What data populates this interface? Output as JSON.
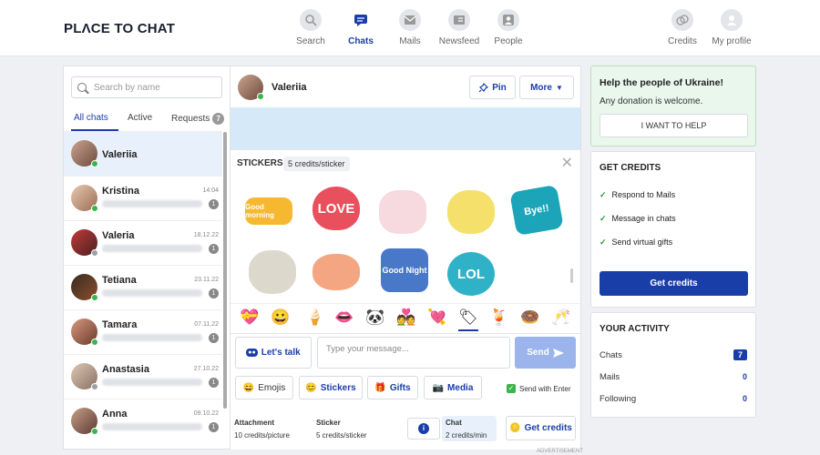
{
  "app": {
    "logo": "PLΛCE TO CHAT"
  },
  "nav": [
    {
      "label": "Search",
      "icon": "search-person-icon"
    },
    {
      "label": "Chats",
      "icon": "chat-icon"
    },
    {
      "label": "Mails",
      "icon": "mail-icon"
    },
    {
      "label": "Newsfeed",
      "icon": "newsfeed-icon"
    },
    {
      "label": "People",
      "icon": "people-icon"
    },
    {
      "label": "Credits",
      "icon": "coins-icon"
    },
    {
      "label": "My profile",
      "icon": "profile-icon"
    }
  ],
  "sidebar": {
    "search_placeholder": "Search by name",
    "tabs": {
      "all": "All chats",
      "active": "Active",
      "requests": "Requests",
      "requests_count": "7"
    },
    "chats": [
      {
        "name": "Valeriia",
        "date": "",
        "count": "",
        "online": true
      },
      {
        "name": "Kristina",
        "date": "14:04",
        "count": "1",
        "online": true
      },
      {
        "name": "Valeria",
        "date": "18.12.22",
        "count": "1",
        "online": false
      },
      {
        "name": "Tetiana",
        "date": "23.11.22",
        "count": "1",
        "online": true
      },
      {
        "name": "Tamara",
        "date": "07.11.22",
        "count": "1",
        "online": true
      },
      {
        "name": "Anastasia",
        "date": "27.10.22",
        "count": "1",
        "online": false
      },
      {
        "name": "Anna",
        "date": "09.10.22",
        "count": "1",
        "online": true
      }
    ]
  },
  "chat": {
    "contact_name": "Valeriia",
    "pin_label": "Pin",
    "more_label": "More",
    "stickers_title": "STICKERS",
    "stickers_price": "5 credits/sticker",
    "sticker_texts": [
      "Good morning",
      "LOVE",
      "",
      "",
      "Bye!!",
      "",
      "",
      "Good Night",
      "LOL"
    ],
    "lets_talk": "Let's talk",
    "message_placeholder": "Type your message...",
    "send_label": "Send",
    "tools": {
      "emojis": "Emojis",
      "stickers": "Stickers",
      "gifts": "Gifts",
      "media": "Media",
      "send_with_enter": "Send with Enter"
    },
    "pricing": {
      "attachment_label": "Attachment",
      "attachment_price": "10 credits/picture",
      "sticker_label": "Sticker",
      "sticker_price": "5 credits/sticker",
      "chat_label": "Chat",
      "chat_price": "2 credits/min"
    },
    "get_credits_label": "Get credits",
    "advertisement": "ADVERTISEMENT"
  },
  "ukraine": {
    "title": "Help the people of Ukraine!",
    "text": "Any donation is welcome.",
    "button": "I WANT TO HELP"
  },
  "credits": {
    "title": "GET CREDITS",
    "items": [
      "Respond to Mails",
      "Message in chats",
      "Send virtual gifts"
    ],
    "button": "Get credits"
  },
  "activity": {
    "title": "YOUR ACTIVITY",
    "rows": [
      {
        "label": "Chats",
        "value": "7"
      },
      {
        "label": "Mails",
        "value": "0"
      },
      {
        "label": "Following",
        "value": "0"
      }
    ]
  },
  "colors": {
    "accent": "#1a3ea8",
    "online": "#39b54a",
    "ukraine_bg": "#eaf7ec"
  }
}
